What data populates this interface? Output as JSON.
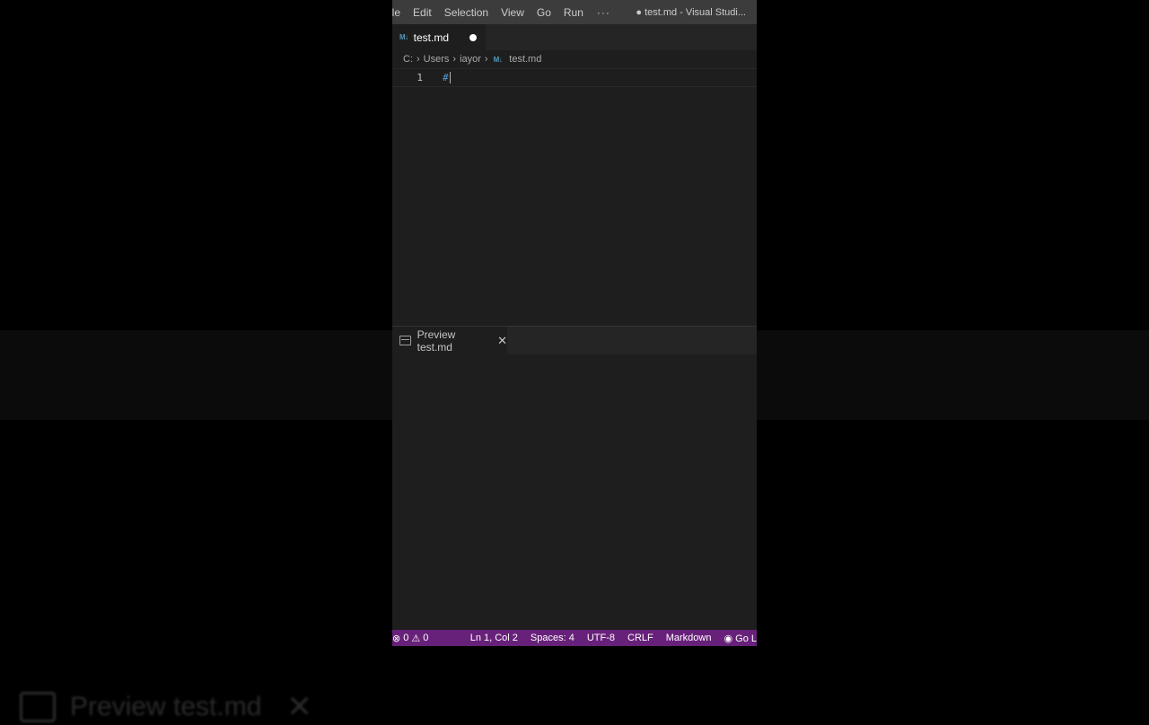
{
  "background": {
    "ghost_label": "Preview test.md",
    "ghost_close": "✕"
  },
  "window": {
    "title": "● test.md - Visual Studi...",
    "menu": [
      "ile",
      "Edit",
      "Selection",
      "View",
      "Go",
      "Run"
    ],
    "menu_more": "···"
  },
  "tab": {
    "icon": "M↓",
    "label": "test.md"
  },
  "breadcrumb": {
    "parts": [
      "C:",
      "Users",
      "iayor"
    ],
    "file_icon": "M↓",
    "file": "test.md"
  },
  "editor": {
    "line_number": "1",
    "line_text": "#"
  },
  "preview": {
    "tab_label": "Preview test.md",
    "close": "✕"
  },
  "status": {
    "errors": "0",
    "warnings": "0",
    "position": "Ln 1, Col 2",
    "spaces": "Spaces: 4",
    "encoding": "UTF-8",
    "eol": "CRLF",
    "language": "Markdown",
    "golive": "Go L"
  },
  "colors": {
    "statusbar": "#68217a",
    "titlebar": "#3c3c3c",
    "editor_bg": "#1e1e1e",
    "md_icon": "#519aba"
  }
}
